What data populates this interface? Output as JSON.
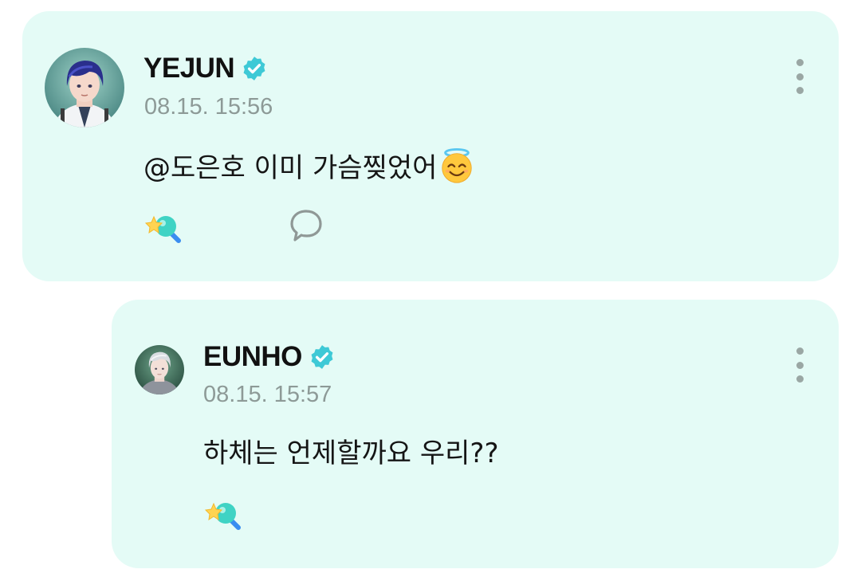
{
  "post": {
    "username": "YEJUN",
    "timestamp": "08.15. 15:56",
    "text": "@도은호 이미 가슴찢었어",
    "emoji": "smiling-face-with-halo-icon",
    "verified": true
  },
  "reply": {
    "username": "EUNHO",
    "timestamp": "08.15. 15:57",
    "text": "하체는 언제할까요 우리??",
    "verified": true
  },
  "colors": {
    "card_background": "#e4fbf6",
    "verified_badge": "#3ec9d6",
    "timestamp": "#8d9a97",
    "more_dots": "#9aa7a4"
  },
  "icons": {
    "verified": "verified-badge-icon",
    "more": "more-vertical-icon",
    "reaction": "star-wand-reaction-icon",
    "comment": "comment-bubble-icon"
  }
}
